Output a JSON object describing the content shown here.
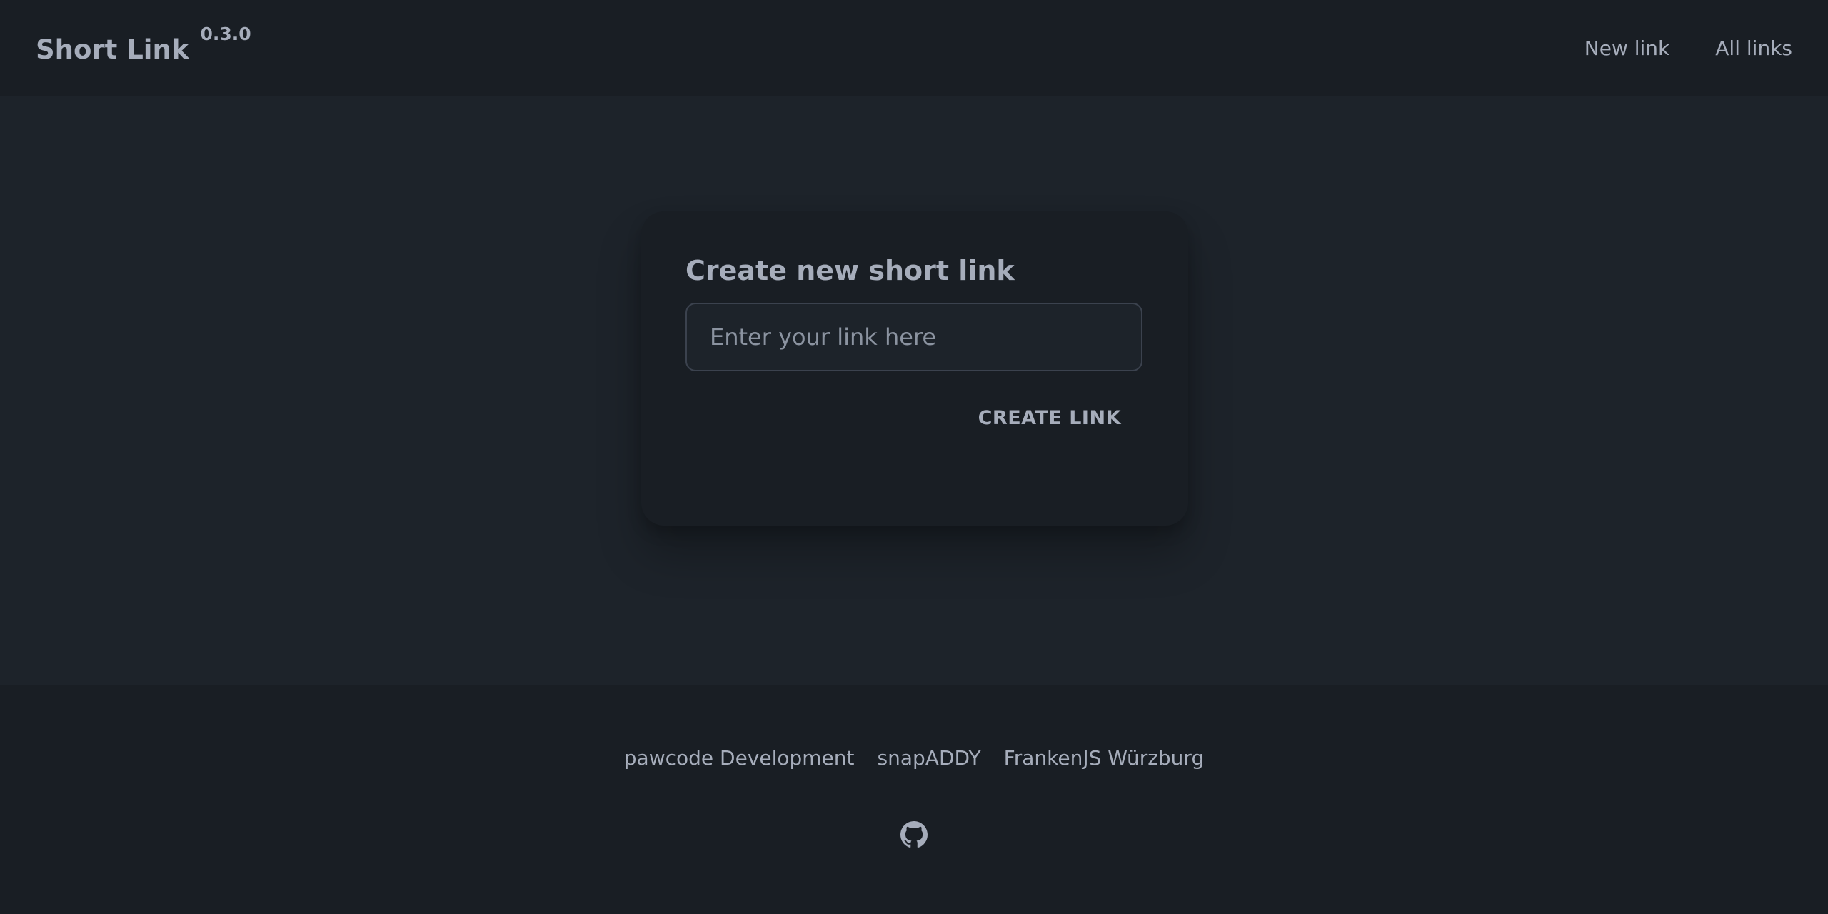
{
  "navbar": {
    "title": "Short Link",
    "version": "0.3.0",
    "links": [
      {
        "label": "New link"
      },
      {
        "label": "All links"
      }
    ]
  },
  "card": {
    "title": "Create new short link",
    "input_placeholder": "Enter your link here",
    "input_value": "",
    "create_button_label": "CREATE LINK"
  },
  "footer": {
    "links": [
      {
        "label": "pawcode Development"
      },
      {
        "label": "snapADDY"
      },
      {
        "label": "FrankenJS Würzburg"
      }
    ],
    "github_icon": "github-icon"
  },
  "colors": {
    "navbar_bg": "#191e24",
    "main_bg": "#1d232a",
    "text": "#a6adbb",
    "input_border": "#3b424e"
  }
}
